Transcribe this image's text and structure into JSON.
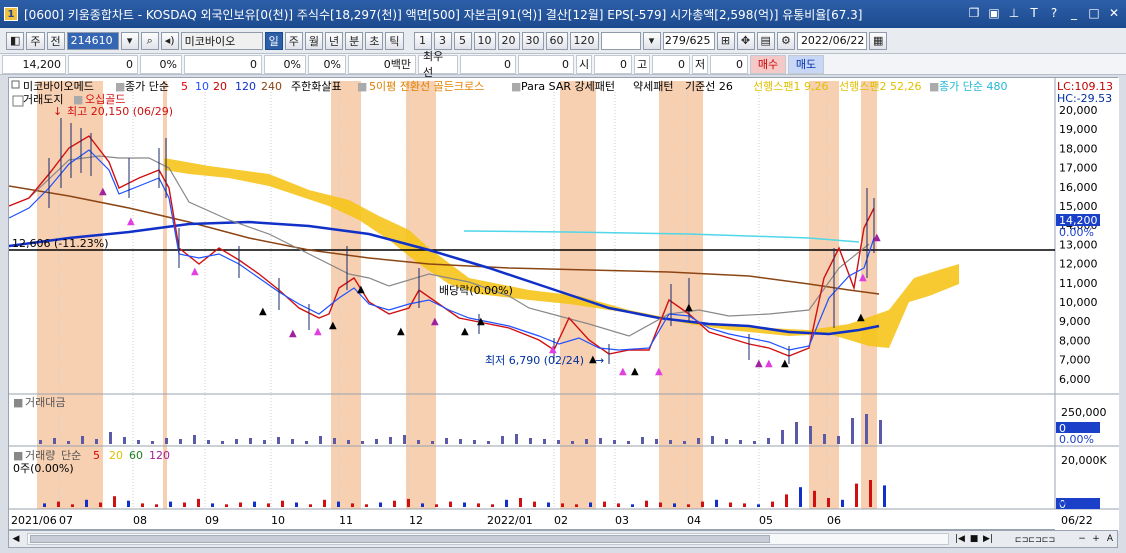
{
  "window": {
    "title": "[0600] 키움종합차트 - KOSDAQ 외국인보유[0(천)] 주식수[18,297(천)] 액면[500] 자본금[91(억)] 결산[12월] EPS[-579] 시가총액[2,598(억)] 유통비율[67.3]",
    "app_icon": "1"
  },
  "toolbar": {
    "period_label": "주",
    "prev_label": "전",
    "code": "214610",
    "stock_name": "미코바이오",
    "tf": [
      "일",
      "주",
      "월",
      "년",
      "분",
      "초",
      "틱"
    ],
    "tf_active": "일",
    "nums": [
      "1",
      "3",
      "5",
      "10",
      "20",
      "30",
      "60",
      "120"
    ],
    "count": "279/625",
    "date": "2022/06/22"
  },
  "infobar": {
    "price": "14,200",
    "c1": "0",
    "p1": "0%",
    "c2": "0",
    "p2": "0%",
    "c3": "0%",
    "vol": "0백만",
    "best_bid_label": "최우선",
    "v1": "0",
    "v2": "0",
    "open_label": "시",
    "v3": "0",
    "high_label": "고",
    "v4": "0",
    "low_label": "저",
    "v5": "0",
    "buy": "매수",
    "sell": "매도"
  },
  "legend": {
    "name": "미코바이오메드",
    "ma_label": "종가 단순",
    "ma5": "5",
    "ma10": "10",
    "ma20": "20",
    "ma120": "120",
    "ma240": "240",
    "ind1": "주한화살표",
    "ind2": "5이평 전환선 골든크로스",
    "ind3": "Para SAR 강세패턴",
    "ind4": "약세패턴",
    "ind5": "기준선 26",
    "ind6": "선행스팬1 9,26",
    "ind7": "선행스팬2 52,26",
    "ind8": "종가 단순 480",
    "line2a": "거래도지",
    "line2b": "오십골드",
    "lc": "LC:109.13",
    "hc": "HC:-29.53"
  },
  "annotations": {
    "high": "최고 20,150 (06/29)",
    "low": "최저 6,790 (02/24)",
    "dividend": "배당락(0.00%)",
    "level": "12,606 (-11.23%)"
  },
  "axis": {
    "price_ticks": [
      "20,000",
      "19,000",
      "18,000",
      "17,000",
      "16,000",
      "15,000",
      "14,000",
      "13,000",
      "12,000",
      "11,000",
      "10,000",
      "9,000",
      "8,000",
      "7,000",
      "6,000"
    ],
    "cur_price": "14,200",
    "cur_pct": "0.00%",
    "months": [
      "2021/06",
      "07",
      "08",
      "09",
      "10",
      "11",
      "12",
      "2022/01",
      "02",
      "03",
      "04",
      "05",
      "06"
    ],
    "last_date": "06/22"
  },
  "panel2": {
    "title": "거래대금",
    "tick": "250,000",
    "v": "0",
    "pct": "0.00%"
  },
  "panel3": {
    "title": "거래량",
    "ma_label": "단순",
    "ma5": "5",
    "ma20": "20",
    "ma60": "60",
    "ma120": "120",
    "value": "0주(0.00%)",
    "tick": "20,000K",
    "v": "0",
    "pct": "0.00%"
  }
}
